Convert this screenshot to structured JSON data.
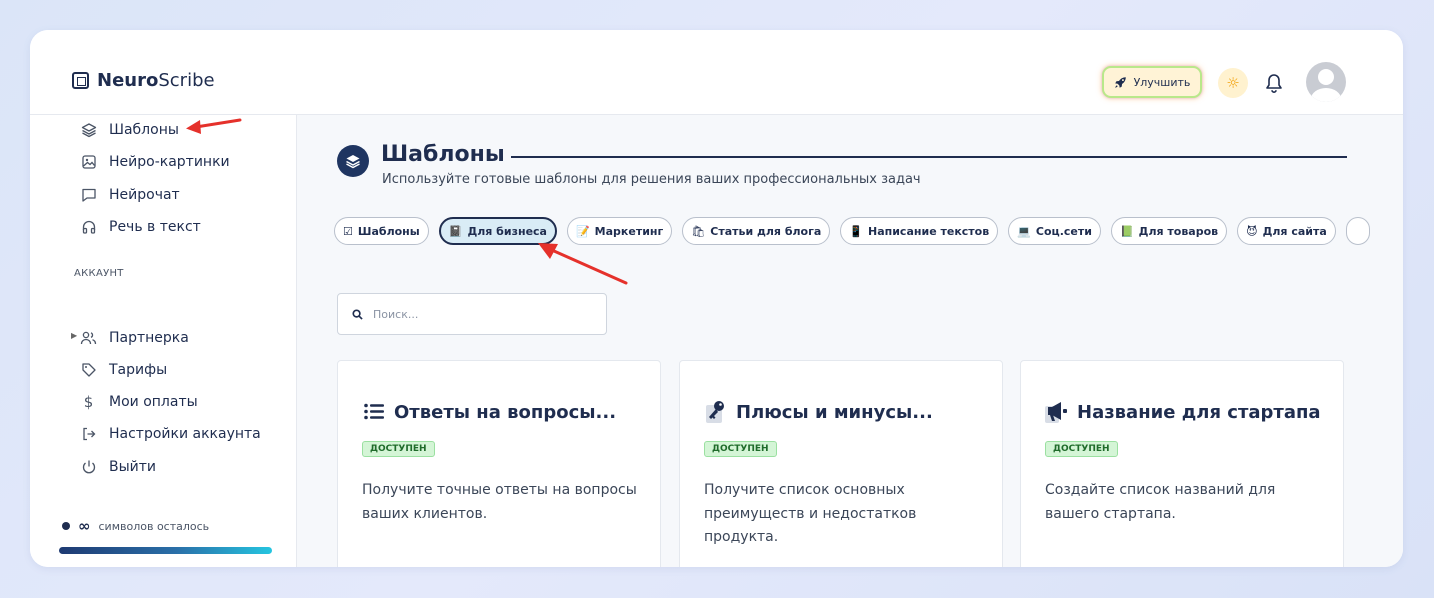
{
  "app": {
    "logo_bold": "Neuro",
    "logo_rest": "Scribe"
  },
  "header": {
    "upgrade_label": "Улучшить"
  },
  "sidebar": {
    "items": [
      {
        "label": "Шаблоны",
        "icon": "layers-icon"
      },
      {
        "label": "Нейро-картинки",
        "icon": "image-icon"
      },
      {
        "label": "Нейрочат",
        "icon": "chat-icon"
      },
      {
        "label": "Речь в текст",
        "icon": "headphones-icon"
      }
    ],
    "section_label": "АККАУНТ",
    "account_items": [
      {
        "label": "Партнерка",
        "icon": "users-icon"
      },
      {
        "label": "Тарифы",
        "icon": "tag-icon"
      },
      {
        "label": "Мои оплаты",
        "icon": "dollar-icon"
      },
      {
        "label": "Настройки аккаунта",
        "icon": "login-icon"
      },
      {
        "label": "Выйти",
        "icon": "power-icon"
      }
    ],
    "credits_symbol": "∞",
    "credits_text": "символов осталось"
  },
  "main": {
    "title": "Шаблоны",
    "subtitle": "Используйте готовые шаблоны для решения ваших профессиональных задач",
    "categories": [
      {
        "label": "Шаблоны",
        "emoji": "☑"
      },
      {
        "label": "Для бизнеса",
        "emoji": "📓"
      },
      {
        "label": "Маркетинг",
        "emoji": "📝"
      },
      {
        "label": "Статьи для блога",
        "emoji": "🛍"
      },
      {
        "label": "Написание текстов",
        "emoji": "📱"
      },
      {
        "label": "Соц.сети",
        "emoji": "💻"
      },
      {
        "label": "Для товаров",
        "emoji": "📗"
      },
      {
        "label": "Для сайта",
        "emoji": "😈"
      }
    ],
    "search_placeholder": "Поиск...",
    "cards": [
      {
        "title": "Ответы на вопросы...",
        "icon": "list-icon",
        "badge": "ДОСТУПЕН",
        "description": "Получите точные ответы на вопросы ваших клиентов."
      },
      {
        "title": "Плюсы и минусы...",
        "icon": "key-icon",
        "badge": "ДОСТУПЕН",
        "description": "Получите список основных преимуществ и недостатков продукта."
      },
      {
        "title": "Название для стартапа",
        "icon": "megaphone-icon",
        "badge": "ДОСТУПЕН",
        "description": "Создайте список названий для вашего стартапа."
      }
    ]
  },
  "colors": {
    "primary": "#1f2d4f",
    "accent_cyan": "#25c5e0",
    "annotation_red": "#e5312b",
    "badge_green": "#d4f5d6"
  }
}
